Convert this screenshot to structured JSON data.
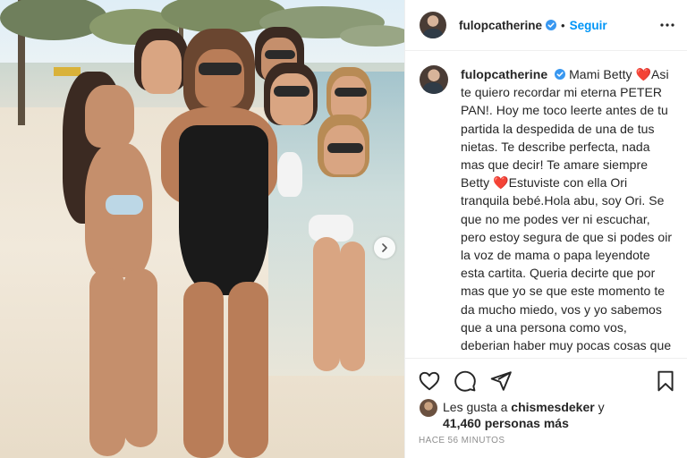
{
  "post": {
    "username": "fulopcatherine",
    "follow_label": "Seguir",
    "caption_parts": [
      "Mami Betty ",
      "❤️",
      "Asi te quiero recordar mi eterna PETER PAN!. Hoy me toco leerte antes de tu partida la despedida de una de tus nietas. Te describe perfecta, nada mas que decir! Te amare siempre Betty ",
      "❤️",
      "Estuviste con ella Ori tranquila bebé.Hola abu, soy Ori. Se que no me podes ver ni escuchar, pero estoy segura de que si podes oir la voz de mama o papa leyendote esta cartita. Queria decirte que por mas que yo se que este momento te da mucho miedo, vos y yo sabemos que a una persona como vos, deberian haber muy pocas cosas que le muevan el piso. A pesar de todas las cosas que te pasaron a lo largo de tu vida, siempre fuiste fuerte"
    ],
    "likes_prefix": "Les gusta a ",
    "likes_user": "chismesdeker",
    "likes_joiner": " y",
    "likes_count": "41,460 personas más",
    "timestamp": "HACE 56 MINUTOS"
  },
  "icons": {
    "verified": "verified-badge-icon",
    "more": "more-options-icon",
    "like": "heart-icon",
    "comment": "comment-icon",
    "share": "paper-plane-icon",
    "save": "bookmark-icon",
    "next": "chevron-right-icon"
  },
  "colors": {
    "accent": "#0095f6",
    "heart": "#ed4956",
    "muted": "#8e8e8e",
    "text": "#262626"
  }
}
